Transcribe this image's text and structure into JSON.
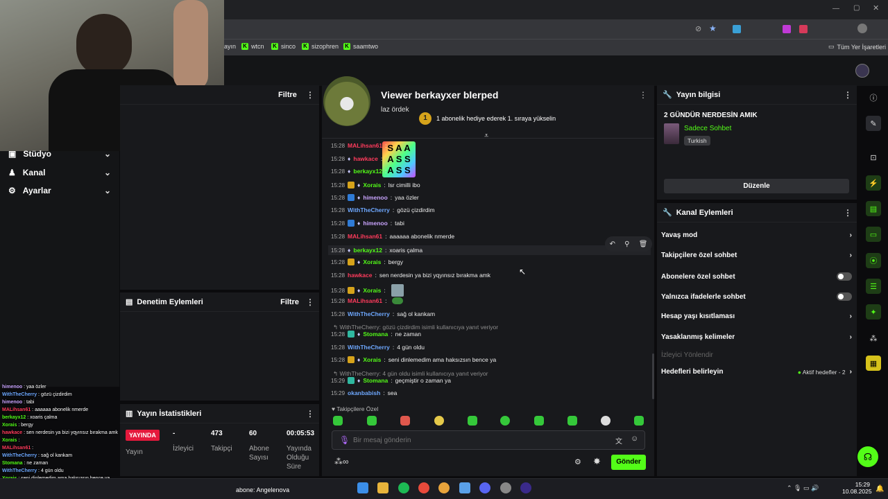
{
  "browser": {
    "bookmarks": [
      {
        "label": "ayın"
      },
      {
        "label": "wtcn"
      },
      {
        "label": "sinco"
      },
      {
        "label": "sizophren"
      },
      {
        "label": "saamtwo"
      }
    ],
    "bookmarks_folder": "Tüm Yer İşaretleri"
  },
  "sidebar": {
    "items": [
      {
        "label": "Stüdyo",
        "icon": "studio-icon"
      },
      {
        "label": "Kanal",
        "icon": "channel-icon"
      },
      {
        "label": "Ayarlar",
        "icon": "settings-icon"
      }
    ]
  },
  "left_panels": {
    "top_filter": "Filtre",
    "moderation_title": "Denetim Eylemleri",
    "moderation_filter": "Filtre",
    "stats_title": "Yayın İstatistikleri",
    "stats": {
      "live_badge": "YAYINDA",
      "live_label": "Yayın",
      "viewers_value": "-",
      "viewers_label": "İzleyici",
      "followers_value": "473",
      "followers_label": "Takipçi",
      "subs_value": "60",
      "subs_label": "Abone Sayısı",
      "uptime_value": "00:05:53",
      "uptime_label": "Yayında Olduğu Süre"
    }
  },
  "chat": {
    "pinned_title": "Viewer berkayxer blerped",
    "pinned_subtitle": "laz ördek",
    "gift_rank": "1",
    "gift_text": "1 abonelik hediye ederek 1. sıraya yükselin",
    "messages": [
      {
        "time": "15:28",
        "user": "MALihsan61",
        "text": "",
        "color": "#ff3b5c"
      },
      {
        "time": "15:28",
        "user": "hawkace",
        "text": "",
        "color": "#ff3b5c"
      },
      {
        "time": "15:28",
        "user": "berkayx12",
        "text": "",
        "color": "#53fc18"
      },
      {
        "time": "15:28",
        "user": "Xorais",
        "text": "lsr cimilli ibo",
        "color": "#53fc18"
      },
      {
        "time": "15:28",
        "user": "himenoo",
        "text": "yaa özler",
        "color": "#c9a4ff"
      },
      {
        "time": "15:28",
        "user": "WithTheCherry",
        "text": "gözü çizdirdim",
        "color": "#6ea8ff"
      },
      {
        "time": "15:28",
        "user": "himenoo",
        "text": "tabi",
        "color": "#c9a4ff"
      },
      {
        "time": "15:28",
        "user": "MALihsan61",
        "text": "aaaaaa abonelik nmerde",
        "color": "#ff3b5c"
      },
      {
        "time": "15:28",
        "user": "berkayx12",
        "text": "xoaris çalma",
        "color": "#53fc18"
      },
      {
        "time": "15:28",
        "user": "Xorais",
        "text": "bergy",
        "color": "#53fc18"
      },
      {
        "time": "15:28",
        "user": "hawkace",
        "text": "sen nerdesin ya bizi yqyınsız bırakma amk",
        "color": "#ff3b5c"
      },
      {
        "time": "15:28",
        "user": "Xorais",
        "text": "",
        "color": "#53fc18"
      },
      {
        "time": "15:28",
        "user": "MALihsan61",
        "text": "",
        "color": "#ff3b5c"
      },
      {
        "time": "15:28",
        "user": "WithTheCherry",
        "text": "sağ ol kankam",
        "color": "#6ea8ff"
      },
      {
        "time": "15:28",
        "user": "Stomana",
        "text": "ne zaman",
        "color": "#53fc18"
      },
      {
        "time": "15:28",
        "user": "WithTheCherry",
        "text": "4 gün oldu",
        "color": "#6ea8ff"
      },
      {
        "time": "15:28",
        "user": "Xorais",
        "text": "seni dinlemedim ama haksızsın bence ya",
        "color": "#53fc18"
      },
      {
        "time": "15:29",
        "user": "Stomana",
        "text": "geçmiştir o zaman ya",
        "color": "#53fc18"
      },
      {
        "time": "15:29",
        "user": "okanbabish",
        "text": "sea",
        "color": "#6ea8ff"
      }
    ],
    "reply1": "WithTheCherry: gözü çizdirdim isimli kullanıcıya yanıt veriyor",
    "reply2": "WithTheCherry: 4 gün oldu isimli kullanıcıya yanıt veriyor",
    "emote_set_label": "Takipçilere Özel",
    "input_placeholder": "Bir mesaj gönderin",
    "send_label": "Gönder"
  },
  "right_panel": {
    "stream_info_title": "Yayın bilgisi",
    "stream_title": "2 GÜNDÜR NERDESİN AMIK",
    "category": "Sadece Sohbet",
    "language_tag": "Turkish",
    "edit_label": "Düzenle",
    "actions_title": "Kanal Eylemleri",
    "actions": {
      "slow_mode": "Yavaş mod",
      "followers_only": "Takipçilere özel sohbet",
      "subs_only": "Abonelere özel sohbet",
      "emotes_only": "Yalnızca ifadelerle sohbet",
      "account_age": "Hesap yaşı kısıtlaması",
      "banned_words": "Yasaklanmış kelimeler",
      "viewer_director": "İzleyici Yönlendir",
      "goals": "Hedefleri belirleyin",
      "goals_status": "Aktif hedefler - 2"
    }
  },
  "overlay_chat": [
    {
      "user": "himenoo",
      "text": "yaa özler",
      "color": "#c9a4ff"
    },
    {
      "user": "WithTheCherry",
      "text": "gözü çizdirdim",
      "color": "#6ea8ff"
    },
    {
      "user": "himenoo",
      "text": "tabi",
      "color": "#c9a4ff"
    },
    {
      "user": "MALihsan61",
      "text": "aaaaaa abonelik nmerde",
      "color": "#ff3b5c"
    },
    {
      "user": "berkayx12",
      "text": "xoaris çalma",
      "color": "#53fc18"
    },
    {
      "user": "Xorais",
      "text": "bergy",
      "color": "#53fc18"
    },
    {
      "user": "hawkace",
      "text": "sen nerdesin ya bizi yqyınsız bırakma amk",
      "color": "#ff3b5c"
    },
    {
      "user": "Xorais",
      "text": "",
      "color": "#53fc18"
    },
    {
      "user": "MALihsan61",
      "text": "",
      "color": "#ff3b5c"
    },
    {
      "user": "WithTheCherry",
      "text": "sağ ol kankam",
      "color": "#6ea8ff"
    },
    {
      "user": "Stomana",
      "text": "ne zaman",
      "color": "#53fc18"
    },
    {
      "user": "WithTheCherry",
      "text": "4 gün oldu",
      "color": "#6ea8ff"
    },
    {
      "user": "Xorais",
      "text": "seni dinlemedim ama haksızsın bence ya",
      "color": "#53fc18"
    },
    {
      "user": "Stomana",
      "text": "geçmiştir o zaman ya",
      "color": "#53fc18"
    },
    {
      "user": "okanbabish",
      "text": "sea",
      "color": "#6ea8ff"
    }
  ],
  "taskbar": {
    "ticker": "abone: Angelenova",
    "time": "15:29",
    "date": "10.08.2025"
  },
  "colors": {
    "accent": "#53fc18",
    "live": "#e5193c"
  }
}
